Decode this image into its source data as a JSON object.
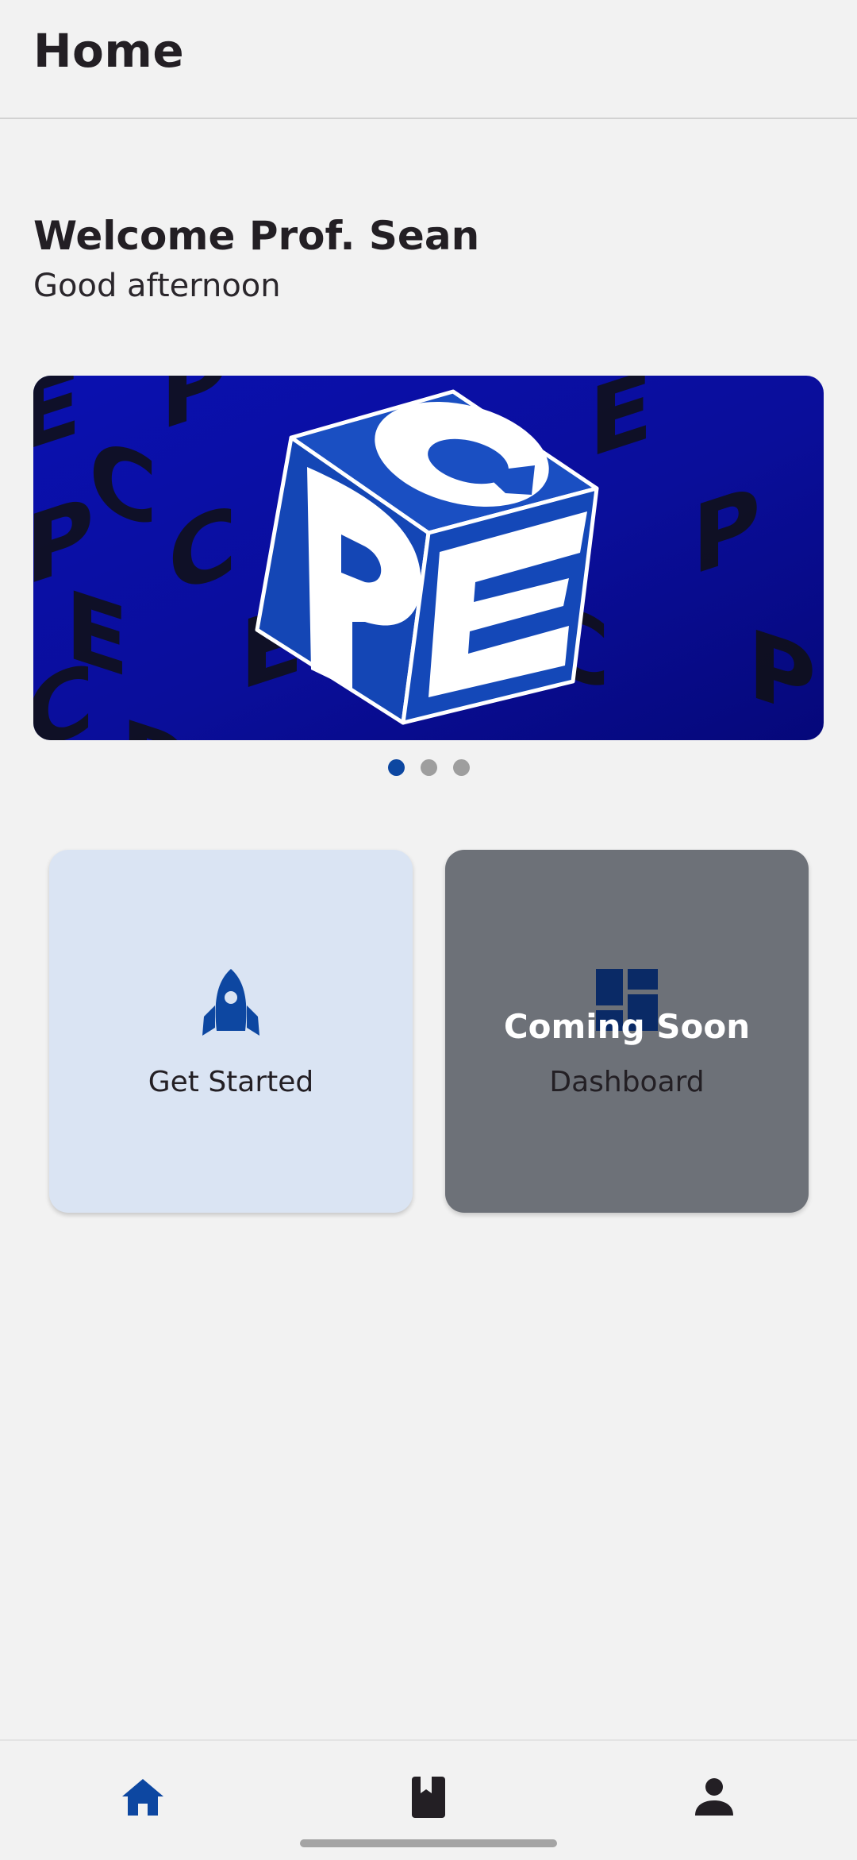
{
  "app_bar": {
    "title": "Home"
  },
  "greeting": {
    "welcome": "Welcome Prof. Sean",
    "subtitle": "Good afternoon"
  },
  "banner": {
    "logo_letters": [
      "C",
      "P",
      "E"
    ],
    "colors": {
      "background": "#0a0fa6",
      "cube": "#1448b8"
    },
    "pages": 3,
    "active_page": 1
  },
  "cards": [
    {
      "label": "Get Started",
      "icon": "rocket-icon",
      "color": "#0d47a1",
      "enabled": true
    },
    {
      "label": "Dashboard",
      "icon": "dashboard-icon",
      "overlay": "Coming Soon",
      "enabled": false
    }
  ],
  "bottom_nav": {
    "items": [
      {
        "icon": "home-icon",
        "active": true
      },
      {
        "icon": "book-icon",
        "active": false
      },
      {
        "icon": "person-icon",
        "active": false
      }
    ]
  },
  "colors": {
    "accent": "#0d47a1",
    "background": "#f2f2f2",
    "card_light": "#dae4f3",
    "card_disabled": "#6d7178"
  }
}
